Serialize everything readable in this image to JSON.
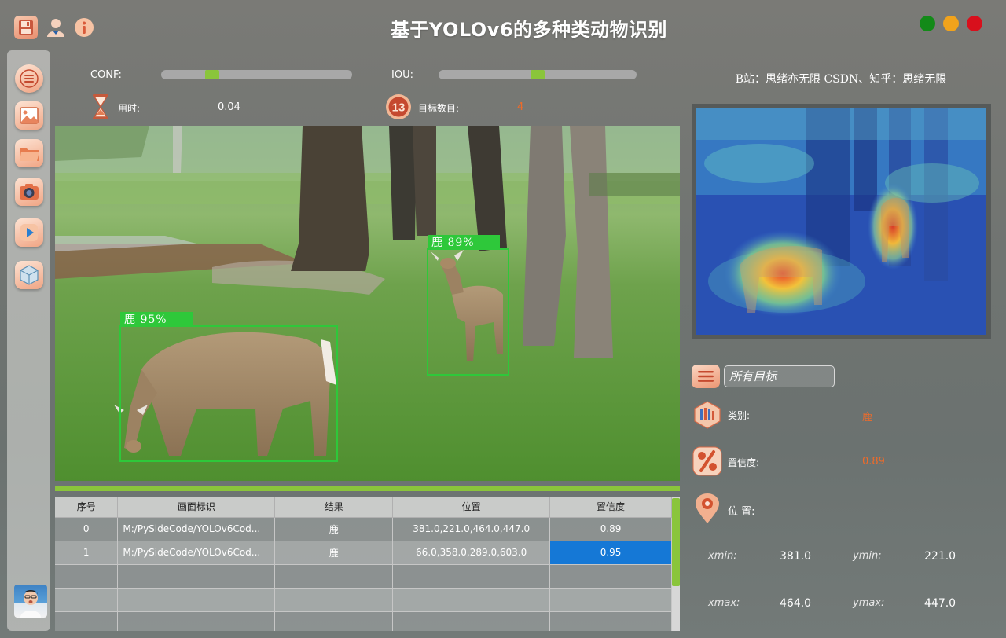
{
  "app": {
    "title": "基于YOLOv6的多种类动物识别"
  },
  "toolbar": {
    "icons": [
      "save-icon",
      "user-icon",
      "info-icon"
    ]
  },
  "window_controls": {
    "colors": [
      "#138a18",
      "#f1a31c",
      "#d8101c"
    ]
  },
  "sidebar": {
    "items": [
      "menu-icon",
      "image-icon",
      "folder-icon",
      "camera-icon",
      "video-play-icon",
      "model-cube-icon"
    ]
  },
  "controls": {
    "conf_label": "CONF:",
    "conf_value": 0.25,
    "iou_label": "IOU:",
    "iou_value": 0.5,
    "time_label": "用时:",
    "time_value": "0.04",
    "count_label": "目标数目:",
    "count_value": "4"
  },
  "detections": [
    {
      "label": "鹿 89%"
    },
    {
      "label": "鹿 95%"
    }
  ],
  "table": {
    "headers": [
      "序号",
      "画面标识",
      "结果",
      "位置",
      "置信度"
    ],
    "rows": [
      {
        "index": "0",
        "source": "M:/PySideCode/YOLOv6Cod...",
        "result": "鹿",
        "position": "381.0,221.0,464.0,447.0",
        "confidence": "0.89"
      },
      {
        "index": "1",
        "source": "M:/PySideCode/YOLOv6Cod...",
        "result": "鹿",
        "position": "66.0,358.0,289.0,603.0",
        "confidence": "0.95"
      }
    ]
  },
  "right_panel": {
    "credit": "B站：思绪亦无限  CSDN、知乎：思绪无限",
    "target_select": "所有目标",
    "class_label": "类别:",
    "class_value": "鹿",
    "conf_label": "置信度:",
    "conf_value": "0.89",
    "position_label": "位 置:",
    "xmin_label": "xmin:",
    "xmin_value": "381.0",
    "ymin_label": "ymin:",
    "ymin_value": "221.0",
    "xmax_label": "xmax:",
    "xmax_value": "464.0",
    "ymax_label": "ymax:",
    "ymax_value": "447.0"
  },
  "colors": {
    "accent_green": "#8ac53b",
    "detection_box": "#2ec83a",
    "highlight_orange": "#ee6b2a",
    "selection_blue": "#1578d6"
  }
}
